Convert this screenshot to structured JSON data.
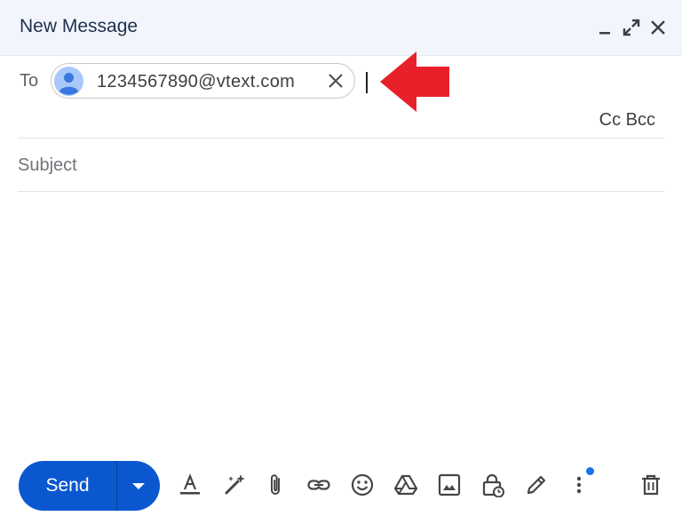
{
  "window": {
    "title": "New Message"
  },
  "recipients": {
    "to_label": "To",
    "chips": [
      {
        "email": "1234567890@vtext.com"
      }
    ],
    "cc_label": "Cc",
    "bcc_label": "Bcc"
  },
  "subject": {
    "placeholder": "Subject",
    "value": ""
  },
  "toolbar": {
    "send_label": "Send",
    "icons": [
      "formatting-options-icon",
      "help-me-write-icon",
      "attach-file-icon",
      "insert-link-icon",
      "insert-emoji-icon",
      "insert-drive-icon",
      "insert-photo-icon",
      "confidential-mode-icon",
      "signature-icon",
      "more-options-icon",
      "discard-draft-icon"
    ]
  },
  "colors": {
    "header_bg": "#f2f6fc",
    "send_button": "#0b57d0",
    "annotation_arrow": "#e8202a",
    "notification_dot": "#1a73e8"
  }
}
